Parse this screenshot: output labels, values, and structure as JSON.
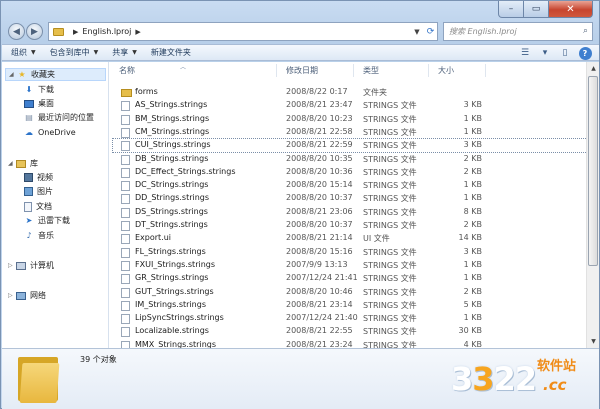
{
  "window": {
    "min_glyph": "–",
    "max_glyph": "▭",
    "close_glyph": "✕"
  },
  "address": {
    "crumb": "English.lproj",
    "search_placeholder": "搜索 English.lproj"
  },
  "toolbar": {
    "organize": "组织",
    "include_in_library": "包含到库中",
    "share": "共享",
    "new_folder": "新建文件夹"
  },
  "sidebar": {
    "favorites": "收藏夹",
    "downloads": "下载",
    "desktop": "桌面",
    "recent": "最近访问的位置",
    "onedrive": "OneDrive",
    "libraries": "库",
    "videos": "视频",
    "pictures": "图片",
    "documents": "文档",
    "thunder": "迅雷下载",
    "music": "音乐",
    "computer": "计算机",
    "network": "网络"
  },
  "columns": {
    "name": "名称",
    "date": "修改日期",
    "type": "类型",
    "size": "大小"
  },
  "files": [
    {
      "name": "forms",
      "date": "2008/8/22 0:17",
      "type": "文件夹",
      "size": "",
      "folder": true
    },
    {
      "name": "AS_Strings.strings",
      "date": "2008/8/21 23:47",
      "type": "STRINGS 文件",
      "size": "3 KB"
    },
    {
      "name": "BM_Strings.strings",
      "date": "2008/8/20 10:23",
      "type": "STRINGS 文件",
      "size": "1 KB"
    },
    {
      "name": "CM_Strings.strings",
      "date": "2008/8/21 22:58",
      "type": "STRINGS 文件",
      "size": "1 KB"
    },
    {
      "name": "CUI_Strings.strings",
      "date": "2008/8/21 22:59",
      "type": "STRINGS 文件",
      "size": "3 KB"
    },
    {
      "name": "DB_Strings.strings",
      "date": "2008/8/20 10:35",
      "type": "STRINGS 文件",
      "size": "2 KB"
    },
    {
      "name": "DC_Effect_Strings.strings",
      "date": "2008/8/20 10:36",
      "type": "STRINGS 文件",
      "size": "2 KB"
    },
    {
      "name": "DC_Strings.strings",
      "date": "2008/8/20 15:14",
      "type": "STRINGS 文件",
      "size": "1 KB"
    },
    {
      "name": "DD_Strings.strings",
      "date": "2008/8/20 10:37",
      "type": "STRINGS 文件",
      "size": "1 KB"
    },
    {
      "name": "DS_Strings.strings",
      "date": "2008/8/21 23:06",
      "type": "STRINGS 文件",
      "size": "8 KB"
    },
    {
      "name": "DT_Strings.strings",
      "date": "2008/8/20 10:37",
      "type": "STRINGS 文件",
      "size": "2 KB"
    },
    {
      "name": "Export.ui",
      "date": "2008/8/21 21:14",
      "type": "UI 文件",
      "size": "14 KB"
    },
    {
      "name": "FL_Strings.strings",
      "date": "2008/8/20 15:16",
      "type": "STRINGS 文件",
      "size": "3 KB"
    },
    {
      "name": "FXUI_Strings.strings",
      "date": "2007/9/9 13:13",
      "type": "STRINGS 文件",
      "size": "1 KB"
    },
    {
      "name": "GR_Strings.strings",
      "date": "2007/12/24 21:41",
      "type": "STRINGS 文件",
      "size": "1 KB"
    },
    {
      "name": "GUT_Strings.strings",
      "date": "2008/8/20 10:46",
      "type": "STRINGS 文件",
      "size": "2 KB"
    },
    {
      "name": "IM_Strings.strings",
      "date": "2008/8/21 23:14",
      "type": "STRINGS 文件",
      "size": "5 KB"
    },
    {
      "name": "LipSyncStrings.strings",
      "date": "2007/12/24 21:40",
      "type": "STRINGS 文件",
      "size": "1 KB"
    },
    {
      "name": "Localizable.strings",
      "date": "2008/8/21 22:55",
      "type": "STRINGS 文件",
      "size": "30 KB"
    },
    {
      "name": "MMX_Strings.strings",
      "date": "2008/8/21 23:24",
      "type": "STRINGS 文件",
      "size": "4 KB"
    }
  ],
  "details": {
    "count": "39 个对象"
  },
  "watermark": {
    "digits_a": "3",
    "digits_b": "3",
    "digits_c": "22",
    "site": "软件站",
    "cc": ".cc"
  }
}
